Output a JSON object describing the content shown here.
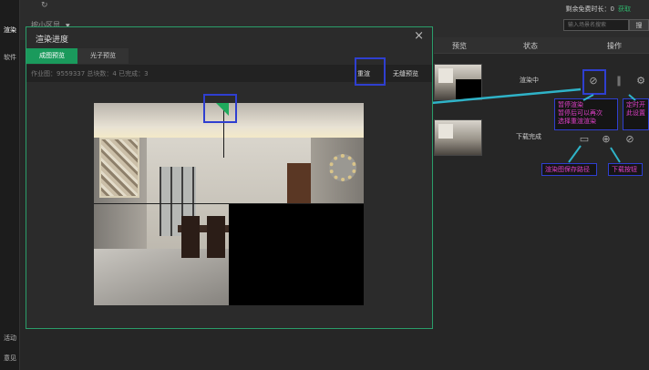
{
  "nav": {
    "render": "渲染",
    "software": "软件",
    "activity": "活动",
    "feedback": "意见"
  },
  "topbar": {
    "dropdown": "按小区显",
    "remaining_label": "剩余免费时长：0",
    "remaining_link": "获取",
    "search_placeholder": "输入场景名搜索",
    "search_button": "搜"
  },
  "table": {
    "headers": [
      "预览",
      "状态",
      "操作"
    ],
    "rows": [
      {
        "status": "渲染中"
      },
      {
        "status": "下载完成"
      }
    ]
  },
  "modal": {
    "title": "渲染进度",
    "tabs": [
      "成图预览",
      "光子预览"
    ],
    "info": "作业图：9559337  总块数：4  已完成：3",
    "rerender": "重渲",
    "seamless": "无缝预览"
  },
  "callouts": {
    "pause": "暂停渲染\n暂停后可以再次\n选择重渲渲染",
    "timing": "定时开\n此设置",
    "save_path": "渲染图保存路径",
    "download": "下载按钮"
  },
  "colors": {
    "accent": "#1a9a5c",
    "annotation": "#2f3fd0",
    "callout_text": "#e040c8",
    "arrow": "#2fb3c8"
  }
}
